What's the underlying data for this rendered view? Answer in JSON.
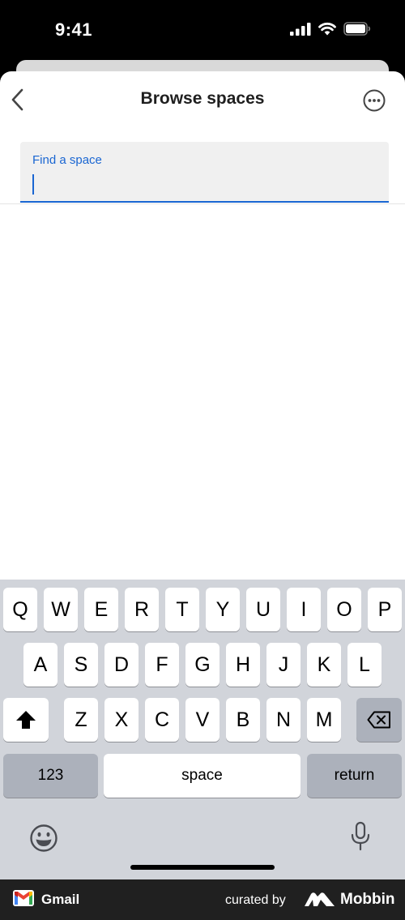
{
  "status_bar": {
    "time": "9:41"
  },
  "header": {
    "title": "Browse spaces"
  },
  "search": {
    "label": "Find a space",
    "value": ""
  },
  "keyboard": {
    "row1": [
      "Q",
      "W",
      "E",
      "R",
      "T",
      "Y",
      "U",
      "I",
      "O",
      "P"
    ],
    "row2": [
      "A",
      "S",
      "D",
      "F",
      "G",
      "H",
      "J",
      "K",
      "L"
    ],
    "row3": [
      "Z",
      "X",
      "C",
      "V",
      "B",
      "N",
      "M"
    ],
    "numbers_label": "123",
    "space_label": "space",
    "return_label": "return"
  },
  "footer": {
    "app_name": "Gmail",
    "curated_by": "curated by",
    "brand": "Mobbin"
  }
}
